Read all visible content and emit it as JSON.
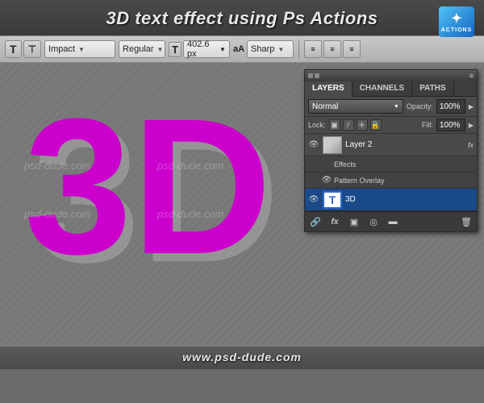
{
  "header": {
    "title": "3D text effect using Ps Actions"
  },
  "actions_badge": {
    "icon": "✦",
    "label": "ACTIONS"
  },
  "toolbar": {
    "tool_T": "T",
    "tool_orient": "T",
    "font_family": "Impact",
    "font_style": "Regular",
    "font_size": "402.6 px",
    "aa_label": "aA",
    "anti_alias": "Sharp",
    "align_left": "≡",
    "align_center": "≡",
    "align_right": "≡"
  },
  "canvas": {
    "text_3d": "3D",
    "watermarks": [
      "psd-dude.com",
      "psd-dude.com",
      "psd-dude.com",
      "psd-dude.com"
    ]
  },
  "layers_panel": {
    "tabs": [
      "LAYERS",
      "CHANNELS",
      "PATHS"
    ],
    "active_tab": "LAYERS",
    "blend_mode": "Normal",
    "opacity_label": "Opacity:",
    "opacity_value": "100%",
    "lock_label": "Lock:",
    "fill_label": "Fill:",
    "fill_value": "100%",
    "layers": [
      {
        "visible": true,
        "thumb_type": "color",
        "name": "Layer 2",
        "has_fx": true
      },
      {
        "visible": false,
        "sub": false,
        "is_group": true,
        "name": "Effects",
        "indent": true
      },
      {
        "visible": false,
        "sub": true,
        "name": "Pattern Overlay",
        "indent": true
      },
      {
        "visible": true,
        "thumb_type": "T",
        "name": "3D",
        "selected": true
      }
    ],
    "bottom_icons": [
      "🔗",
      "fx",
      "▣",
      "◎",
      "▬",
      "🗑"
    ]
  },
  "footer": {
    "url": "www.psd-dude.com"
  }
}
